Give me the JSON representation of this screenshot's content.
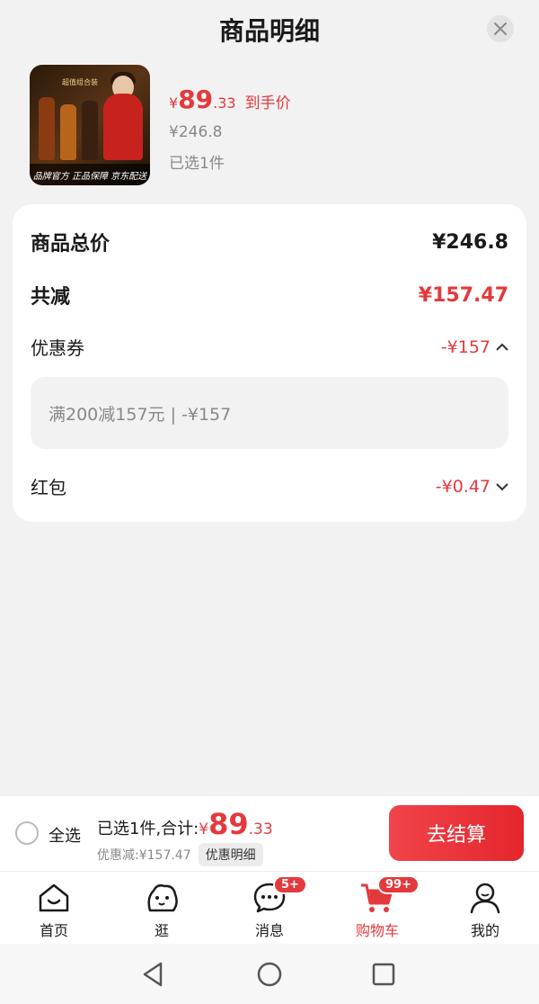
{
  "header": {
    "title": "商品明细",
    "close_icon": "close-icon"
  },
  "product": {
    "thumb_banner": "超值组合装",
    "thumb_strip": "品牌官方  正品保障  京东配送",
    "price_yen": "¥",
    "price_int": "89",
    "price_dec": ".33",
    "price_tag": "到手价",
    "original_price": "¥246.8",
    "selected": "已选1件"
  },
  "summary": {
    "total_label": "商品总价",
    "total_value": "¥246.8",
    "reduce_label": "共减",
    "reduce_value": "¥157.47",
    "coupon_label": "优惠券",
    "coupon_value": "-¥157",
    "coupon_detail": "满200减157元 | -¥157",
    "redpacket_label": "红包",
    "redpacket_value": "-¥0.47"
  },
  "bottom": {
    "select_all": "全选",
    "total_prefix": "已选1件,合计:",
    "total_yen": "¥",
    "total_int": "89",
    "total_dec": ".33",
    "discount_text": "优惠减:¥157.47",
    "detail_button": "优惠明细",
    "checkout": "去结算"
  },
  "tabs": [
    {
      "label": "首页",
      "icon": "home-icon"
    },
    {
      "label": "逛",
      "icon": "mascot-icon"
    },
    {
      "label": "消息",
      "icon": "message-icon",
      "badge": "5+"
    },
    {
      "label": "购物车",
      "icon": "cart-icon",
      "badge": "99+"
    },
    {
      "label": "我的",
      "icon": "user-icon"
    }
  ],
  "colors": {
    "accent": "#e4393c",
    "background": "#f2f2f2"
  }
}
